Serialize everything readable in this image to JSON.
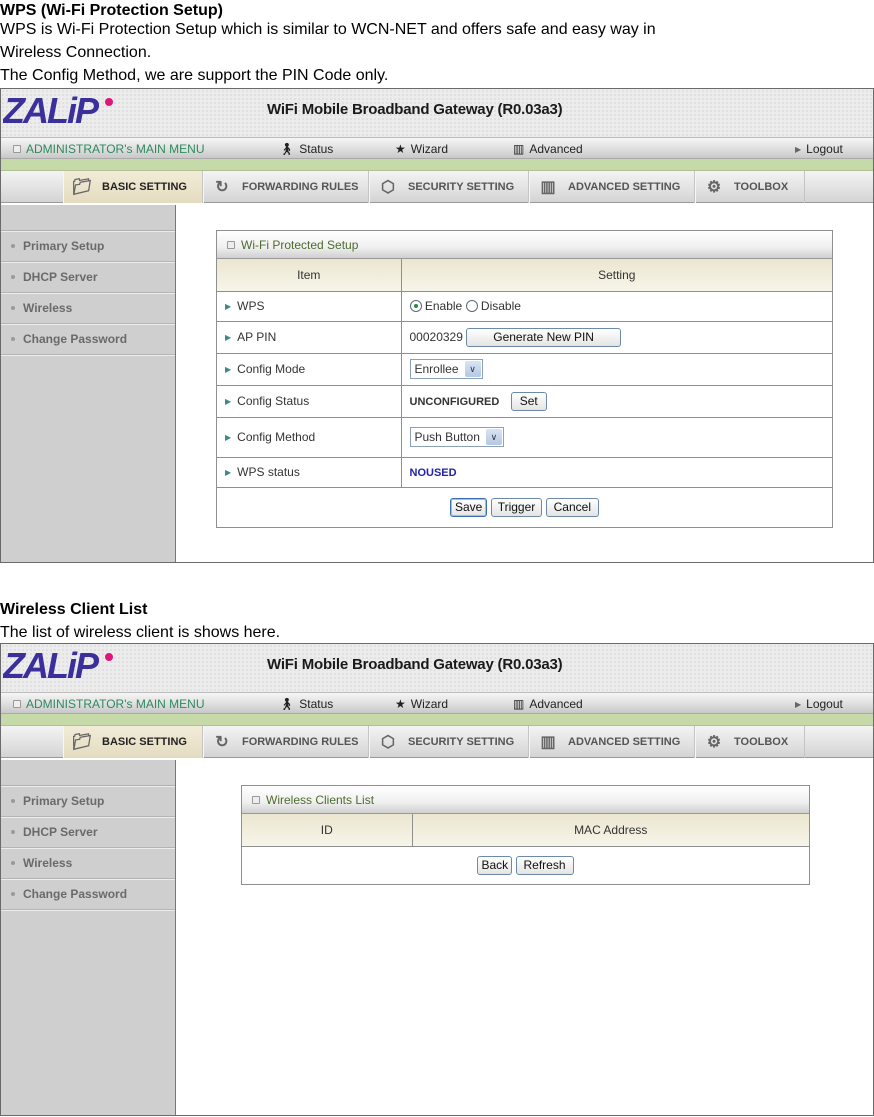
{
  "section1": {
    "heading": "WPS (Wi-Fi Protection Setup)",
    "lines": [
      "WPS is Wi-Fi Protection Setup which is similar to WCN-NET and offers safe and easy way in",
      "Wireless Connection.",
      "The Config Method, we are support the PIN Code only."
    ]
  },
  "section2": {
    "heading": "Wireless Client List",
    "lines": [
      "The list of wireless client is shows here."
    ]
  },
  "router": {
    "logo_text": "ZALiP",
    "title": "WiFi Mobile Broadband Gateway (R0.03a3)",
    "main_menu": {
      "admin_label": "ADMINISTRATOR's MAIN MENU",
      "items": [
        {
          "label": "Status",
          "icon": "status-icon"
        },
        {
          "label": "Wizard",
          "icon": "wizard-icon"
        },
        {
          "label": "Advanced",
          "icon": "advanced-icon"
        }
      ],
      "logout_label": "Logout"
    },
    "sub_nav": [
      {
        "label": "BASIC SETTING",
        "icon": "basic-setting-icon",
        "active": true
      },
      {
        "label": "FORWARDING RULES",
        "icon": "forwarding-rules-icon",
        "active": false
      },
      {
        "label": "SECURITY SETTING",
        "icon": "security-setting-icon",
        "active": false
      },
      {
        "label": "ADVANCED SETTING",
        "icon": "advanced-setting-icon",
        "active": false
      },
      {
        "label": "TOOLBOX",
        "icon": "toolbox-icon",
        "active": false
      }
    ],
    "sidebar": [
      {
        "label": "Primary Setup"
      },
      {
        "label": "DHCP Server"
      },
      {
        "label": "Wireless"
      },
      {
        "label": "Change Password"
      }
    ]
  },
  "wps_panel": {
    "title": "Wi-Fi Protected Setup",
    "col_item": "Item",
    "col_setting": "Setting",
    "rows": {
      "wps": {
        "label": "WPS",
        "enable_label": "Enable",
        "disable_label": "Disable",
        "selected": "Enable"
      },
      "ap_pin": {
        "label": "AP PIN",
        "value": "00020329",
        "button": "Generate New PIN"
      },
      "config_mode": {
        "label": "Config Mode",
        "value": "Enrollee"
      },
      "config_status": {
        "label": "Config Status",
        "value": "UNCONFIGURED",
        "button": "Set"
      },
      "config_method": {
        "label": "Config Method",
        "value": "Push Button"
      },
      "wps_status": {
        "label": "WPS status",
        "value": "NOUSED",
        "color": "#2222aa"
      }
    },
    "buttons": {
      "save": "Save",
      "trigger": "Trigger",
      "cancel": "Cancel"
    }
  },
  "clients_panel": {
    "title": "Wireless Clients List",
    "col_id": "ID",
    "col_mac": "MAC Address",
    "buttons": {
      "back": "Back",
      "refresh": "Refresh"
    }
  }
}
